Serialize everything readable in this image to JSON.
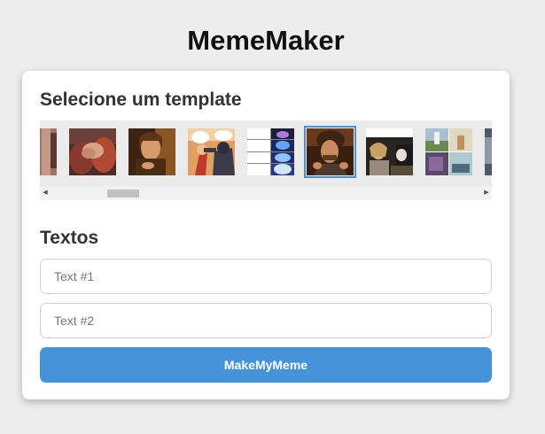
{
  "app": {
    "title": "MemeMaker"
  },
  "templates": {
    "heading": "Selecione um template",
    "items": [
      {
        "icon": "partial-meme-thumbnail-icon"
      },
      {
        "icon": "handshake-meme-thumbnail-icon"
      },
      {
        "icon": "one-does-not-simply-thumbnail-icon"
      },
      {
        "icon": "batman-slapping-robin-thumbnail-icon"
      },
      {
        "icon": "expanding-brain-thumbnail-icon"
      },
      {
        "icon": "ancient-aliens-guy-thumbnail-icon",
        "selected": true
      },
      {
        "icon": "woman-yelling-at-cat-thumbnail-icon"
      },
      {
        "icon": "left-exit-ramp-thumbnail-icon"
      },
      {
        "icon": "partial-meme-thumbnail-icon"
      }
    ]
  },
  "texts": {
    "heading": "Textos",
    "field1_placeholder": "Text #1",
    "field2_placeholder": "Text #2"
  },
  "actions": {
    "make_label": "MakeMyMeme"
  },
  "colors": {
    "accent": "#4594d9",
    "selected_outline": "#4a90d9",
    "background": "#ededed"
  }
}
